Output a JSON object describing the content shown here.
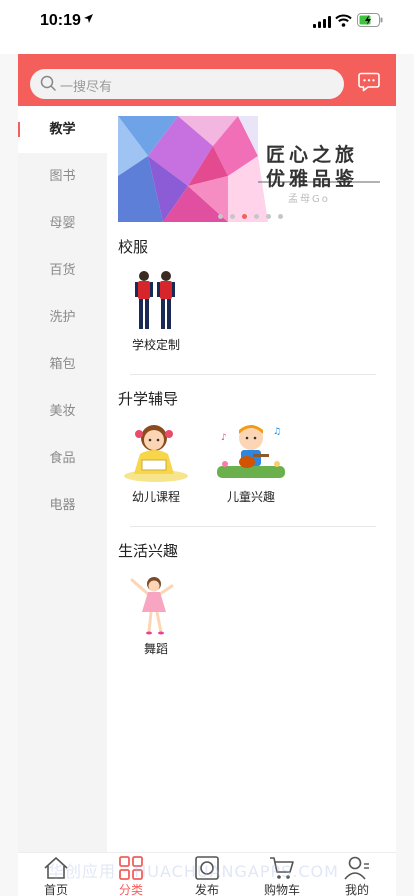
{
  "status_bar": {
    "time": "10:19"
  },
  "colors": {
    "accent": "#f45e5b",
    "sidebar_bg": "#f4f4f4",
    "search_bg": "#f2f2f2"
  },
  "header": {
    "search_placeholder": "一搜尽有",
    "message_icon": "chat-bubble-icon"
  },
  "sidebar": {
    "selected": "教学",
    "items": [
      {
        "label": "教学"
      },
      {
        "label": "图书"
      },
      {
        "label": "母婴"
      },
      {
        "label": "百货"
      },
      {
        "label": "洗护"
      },
      {
        "label": "箱包"
      },
      {
        "label": "美妆"
      },
      {
        "label": "食品"
      },
      {
        "label": "电器"
      }
    ]
  },
  "banner": {
    "line1": "匠心之旅",
    "line2": "优雅品鉴",
    "logo": "孟母Go",
    "slide_count": 6,
    "active_slide": 3
  },
  "sections": [
    {
      "title": "校服",
      "items": [
        {
          "label": "学校定制",
          "image": "school-uniform-illustration"
        }
      ]
    },
    {
      "title": "升学辅导",
      "items": [
        {
          "label": "幼儿课程",
          "image": "girl-reading-illustration"
        },
        {
          "label": "儿童兴趣",
          "image": "boy-guitar-illustration"
        }
      ]
    },
    {
      "title": "生活兴趣",
      "items": [
        {
          "label": "舞蹈",
          "image": "dancing-girl-illustration"
        }
      ]
    }
  ],
  "tabbar": {
    "active": "分类",
    "tabs": [
      {
        "label": "首页",
        "icon": "home-icon"
      },
      {
        "label": "分类",
        "icon": "grid-icon"
      },
      {
        "label": "发布",
        "icon": "publish-icon"
      },
      {
        "label": "购物车",
        "icon": "cart-icon"
      },
      {
        "label": "我的",
        "icon": "user-icon"
      }
    ]
  },
  "watermark": "华创应用 · HUACHUANGAPPS.COM"
}
